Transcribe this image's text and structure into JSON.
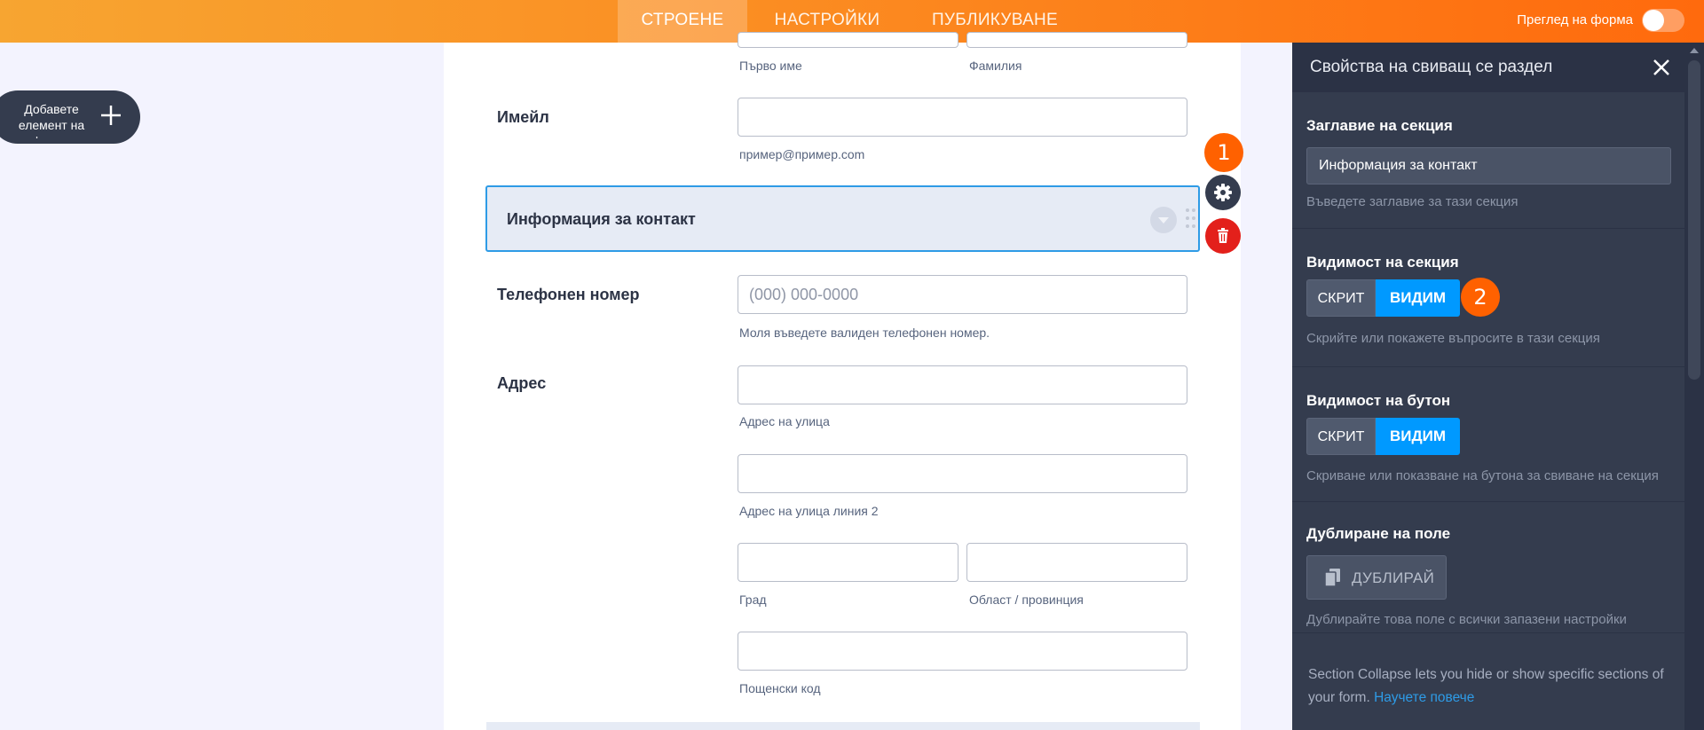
{
  "topbar": {
    "tabs": [
      {
        "label": "СТРОЕНЕ",
        "active": true
      },
      {
        "label": "НАСТРОЙКИ",
        "active": false
      },
      {
        "label": "ПУБЛИКУВАНЕ",
        "active": false
      }
    ],
    "preview_label": "Преглед на форма",
    "preview_on": false
  },
  "add_element": {
    "label": "Добавете елемент на форма",
    "icon": "plus-icon"
  },
  "form": {
    "name_sublabels": {
      "first": "Първо име",
      "last": "Фамилия"
    },
    "email": {
      "label": "Имейл",
      "sublabel": "пример@пример.com",
      "value": ""
    },
    "section": {
      "title": "Информация за контакт"
    },
    "phone": {
      "label": "Телефонен номер",
      "placeholder": "(000) 000-0000",
      "sublabel": "Моля въведете валиден телефонен номер."
    },
    "address": {
      "label": "Адрес",
      "street": "Адрес на улица",
      "street2": "Адрес на улица линия 2",
      "city": "Град",
      "state": "Област / провинция",
      "zip": "Пощенски код"
    }
  },
  "badges": {
    "one": "1",
    "two": "2"
  },
  "panel": {
    "title": "Свойства на свиващ се раздел",
    "section_title": {
      "label": "Заглавие на секция",
      "value": "Информация за контакт",
      "hint": "Въведете заглавие за тази секция"
    },
    "section_visibility": {
      "label": "Видимост на секция",
      "off": "СКРИТ",
      "on": "ВИДИМ",
      "hint": "Скрийте или покажете въпросите в тази секция"
    },
    "button_visibility": {
      "label": "Видимост на бутон",
      "off": "СКРИТ",
      "on": "ВИДИМ",
      "hint": "Скриване или показване на бутона за свиване на секция"
    },
    "duplicate": {
      "label": "Дублиране на поле",
      "button": "ДУБЛИРАЙ",
      "hint": "Дублирайте това поле с всички запазени настройки"
    },
    "info_text": "Section Collapse lets you hide or show specific sections of your form.",
    "info_link": "Научете повече"
  },
  "colors": {
    "accent": "#ff6100",
    "blue": "#0099ff",
    "panel": "#343c4e",
    "danger": "#e3201b"
  }
}
